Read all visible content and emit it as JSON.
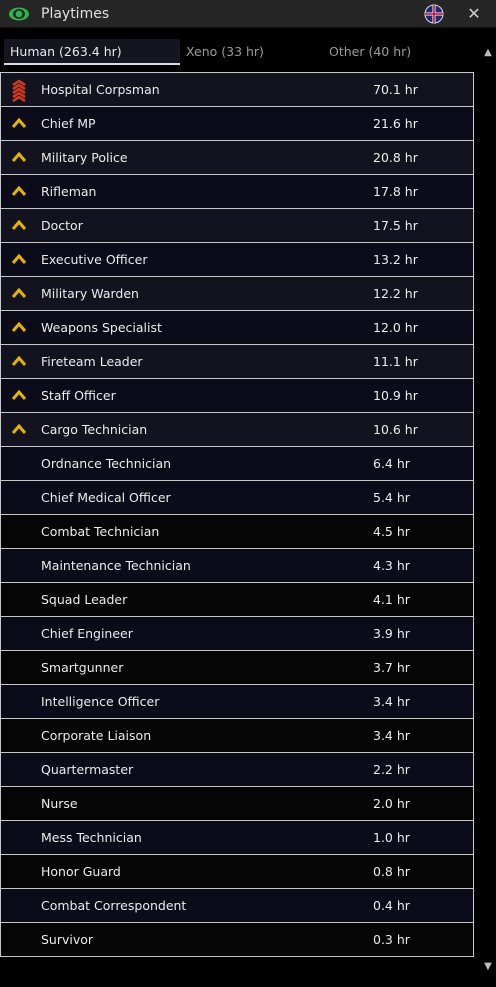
{
  "window": {
    "title": "Playtimes",
    "close_glyph": "✕"
  },
  "tabs": [
    {
      "label": "Human (263.4 hr)",
      "active": true
    },
    {
      "label": "Xeno (33 hr)",
      "active": false
    },
    {
      "label": "Other (40 hr)",
      "active": false
    }
  ],
  "rows": [
    {
      "label": "Hospital Corpsman",
      "time": "70.1 hr",
      "icon": "corpsman-rank-icon"
    },
    {
      "label": "Chief MP",
      "time": "21.6 hr",
      "icon": "chevron-rank-icon"
    },
    {
      "label": "Military Police",
      "time": "20.8 hr",
      "icon": "chevron-rank-icon"
    },
    {
      "label": "Rifleman",
      "time": "17.8 hr",
      "icon": "chevron-rank-icon"
    },
    {
      "label": "Doctor",
      "time": "17.5 hr",
      "icon": "chevron-rank-icon"
    },
    {
      "label": "Executive Officer",
      "time": "13.2 hr",
      "icon": "chevron-rank-icon"
    },
    {
      "label": "Military Warden",
      "time": "12.2 hr",
      "icon": "chevron-rank-icon"
    },
    {
      "label": "Weapons Specialist",
      "time": "12.0 hr",
      "icon": "chevron-rank-icon"
    },
    {
      "label": "Fireteam Leader",
      "time": "11.1 hr",
      "icon": "chevron-rank-icon"
    },
    {
      "label": "Staff Officer",
      "time": "10.9 hr",
      "icon": "chevron-rank-icon"
    },
    {
      "label": "Cargo Technician",
      "time": "10.6 hr",
      "icon": "chevron-rank-icon"
    },
    {
      "label": "Ordnance Technician",
      "time": "6.4 hr",
      "icon": ""
    },
    {
      "label": "Chief Medical Officer",
      "time": "5.4 hr",
      "icon": ""
    },
    {
      "label": "Combat Technician",
      "time": "4.5 hr",
      "icon": ""
    },
    {
      "label": "Maintenance Technician",
      "time": "4.3 hr",
      "icon": ""
    },
    {
      "label": "Squad Leader",
      "time": "4.1 hr",
      "icon": ""
    },
    {
      "label": "Chief Engineer",
      "time": "3.9 hr",
      "icon": ""
    },
    {
      "label": "Smartgunner",
      "time": "3.7 hr",
      "icon": ""
    },
    {
      "label": "Intelligence Officer",
      "time": "3.4 hr",
      "icon": ""
    },
    {
      "label": "Corporate Liaison",
      "time": "3.4 hr",
      "icon": ""
    },
    {
      "label": "Quartermaster",
      "time": "2.2 hr",
      "icon": ""
    },
    {
      "label": "Nurse",
      "time": "2.0 hr",
      "icon": ""
    },
    {
      "label": "Mess Technician",
      "time": "1.0 hr",
      "icon": ""
    },
    {
      "label": "Honor Guard",
      "time": "0.8 hr",
      "icon": ""
    },
    {
      "label": "Combat Correspondent",
      "time": "0.4 hr",
      "icon": ""
    },
    {
      "label": "Survivor",
      "time": "0.3 hr",
      "icon": ""
    }
  ],
  "colors": {
    "accent_green": "#2fb34a",
    "rank_gold": "#e8b400",
    "rank_red": "#d23a1e",
    "row_border": "#c8c8c8"
  }
}
